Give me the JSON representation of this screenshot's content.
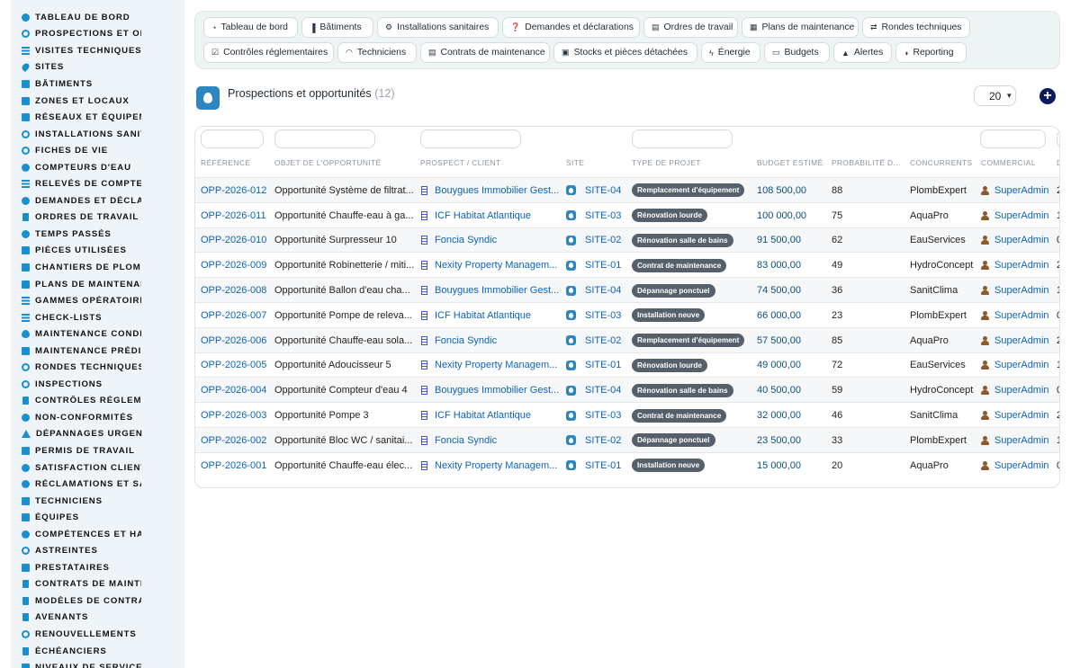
{
  "sidebar": {
    "items": [
      {
        "label": "TABLEAU DE BORD",
        "icon": "dashboard-icon"
      },
      {
        "label": "PROSPECTIONS ET OPPORTUNITÉS",
        "icon": "target-icon"
      },
      {
        "label": "VISITES TECHNIQUES ET AUDITS",
        "icon": "list-icon"
      },
      {
        "label": "SITES",
        "icon": "map-pin-icon"
      },
      {
        "label": "BÂTIMENTS",
        "icon": "building-icon"
      },
      {
        "label": "ZONES ET LOCAUX",
        "icon": "grid-icon"
      },
      {
        "label": "RÉSEAUX ET ÉQUIPEMENTS",
        "icon": "network-icon"
      },
      {
        "label": "INSTALLATIONS SANITAIRES",
        "icon": "cogs-icon"
      },
      {
        "label": "FICHES DE VIE",
        "icon": "history-icon"
      },
      {
        "label": "COMPTEURS D'EAU",
        "icon": "gauge-icon"
      },
      {
        "label": "RELEVÉS DE COMPTEURS",
        "icon": "list-icon"
      },
      {
        "label": "DEMANDES ET DÉCLARATIONS",
        "icon": "question-icon"
      },
      {
        "label": "ORDRES DE TRAVAIL",
        "icon": "clipboard-icon"
      },
      {
        "label": "TEMPS PASSÉS",
        "icon": "clock-icon"
      },
      {
        "label": "PIÈCES UTILISÉES",
        "icon": "boxes-icon"
      },
      {
        "label": "CHANTIERS DE PLOMBERIE",
        "icon": "hammer-icon"
      },
      {
        "label": "PLANS DE MAINTENANCE",
        "icon": "calendar-icon"
      },
      {
        "label": "GAMMES OPÉRATOIRES",
        "icon": "tasks-icon"
      },
      {
        "label": "CHECK-LISTS",
        "icon": "checklist-icon"
      },
      {
        "label": "MAINTENANCE CONDITIONNELLE",
        "icon": "thermometer-icon"
      },
      {
        "label": "MAINTENANCE PRÉDICTIVE",
        "icon": "chart-icon"
      },
      {
        "label": "RONDES TECHNIQUES",
        "icon": "route-icon"
      },
      {
        "label": "INSPECTIONS",
        "icon": "search-icon"
      },
      {
        "label": "CONTRÔLES RÉGLEMENTAIRES",
        "icon": "clipboard-check-icon"
      },
      {
        "label": "NON-CONFORMITÉS",
        "icon": "alert-circle-icon"
      },
      {
        "label": "DÉPANNAGES URGENTS",
        "icon": "warning-icon"
      },
      {
        "label": "PERMIS DE TRAVAIL",
        "icon": "id-card-icon"
      },
      {
        "label": "SATISFACTION CLIENT",
        "icon": "smile-icon"
      },
      {
        "label": "RÉCLAMATIONS ET SAV",
        "icon": "comment-icon"
      },
      {
        "label": "TECHNICIENS",
        "icon": "helmet-icon"
      },
      {
        "label": "ÉQUIPES",
        "icon": "users-icon"
      },
      {
        "label": "COMPÉTENCES ET HABILITATIONS",
        "icon": "certificate-icon"
      },
      {
        "label": "ASTREINTES",
        "icon": "phone-icon"
      },
      {
        "label": "PRESTATAIRES",
        "icon": "truck-icon"
      },
      {
        "label": "CONTRATS DE MAINTENANCE",
        "icon": "file-contract-icon"
      },
      {
        "label": "MODÈLES DE CONTRATS",
        "icon": "file-icon"
      },
      {
        "label": "AVENANTS",
        "icon": "file-edit-icon"
      },
      {
        "label": "RENOUVELLEMENTS",
        "icon": "refresh-icon"
      },
      {
        "label": "ÉCHÉANCIERS",
        "icon": "file-invoice-icon"
      },
      {
        "label": "NIVEAUX DE SERVICE (SLA)",
        "icon": "shield-icon"
      }
    ]
  },
  "topnav": {
    "row1": [
      {
        "label": "Tableau de bord",
        "icon": "dashboard-icon"
      },
      {
        "label": "Bâtiments",
        "icon": "building-icon"
      },
      {
        "label": "Installations sanitaires",
        "icon": "cogs-icon"
      },
      {
        "label": "Demandes et déclarations",
        "icon": "question-icon"
      },
      {
        "label": "Ordres de travail",
        "icon": "clipboard-icon"
      },
      {
        "label": "Plans de maintenance",
        "icon": "calendar-icon"
      },
      {
        "label": "Rondes techniques",
        "icon": "route-icon"
      }
    ],
    "row2": [
      {
        "label": "Contrôles réglementaires",
        "icon": "clipboard-check-icon"
      },
      {
        "label": "Techniciens",
        "icon": "helmet-icon"
      },
      {
        "label": "Contrats de maintenance",
        "icon": "file-contract-icon"
      },
      {
        "label": "Stocks et pièces détachées",
        "icon": "boxes-icon"
      },
      {
        "label": "Énergie",
        "icon": "bolt-icon"
      },
      {
        "label": "Budgets",
        "icon": "money-icon"
      },
      {
        "label": "Alertes",
        "icon": "bell-icon"
      },
      {
        "label": "Reporting",
        "icon": "pie-chart-icon"
      }
    ]
  },
  "page": {
    "title": "Prospections et opportunités",
    "count": "(12)",
    "page_size": "20",
    "add_icon": "plus-icon"
  },
  "table": {
    "columns": [
      "RÉFÉRENCE",
      "OBJET DE L'OPPORTUNITÉ",
      "PROSPECT / CLIENT",
      "SITE",
      "TYPE DE PROJET",
      "BUDGET ESTIMÉ",
      "PROBABILITÉ D...",
      "CONCURRENTS",
      "COMMERCIAL",
      "D"
    ],
    "rows": [
      {
        "ref": "OPP-2026-012",
        "objet": "Opportunité Système de filtrat...",
        "client": "Bouygues Immobilier Gest...",
        "site": "SITE-04",
        "type": "Remplacement d'équipement",
        "budget": "108 500,00",
        "proba": "88",
        "concurrent": "PlombExpert",
        "commercial": "SuperAdmin",
        "d": "2"
      },
      {
        "ref": "OPP-2026-011",
        "objet": "Opportunité Chauffe-eau à ga...",
        "client": "ICF Habitat Atlantique",
        "site": "SITE-03",
        "type": "Rénovation lourde",
        "budget": "100 000,00",
        "proba": "75",
        "concurrent": "AquaPro",
        "commercial": "SuperAdmin",
        "d": "1"
      },
      {
        "ref": "OPP-2026-010",
        "objet": "Opportunité Surpresseur 10",
        "client": "Foncia Syndic",
        "site": "SITE-02",
        "type": "Rénovation salle de bains",
        "budget": "91 500,00",
        "proba": "62",
        "concurrent": "EauServices",
        "commercial": "SuperAdmin",
        "d": "0"
      },
      {
        "ref": "OPP-2026-009",
        "objet": "Opportunité Robinetterie / miti...",
        "client": "Nexity Property Managem...",
        "site": "SITE-01",
        "type": "Contrat de maintenance",
        "budget": "83 000,00",
        "proba": "49",
        "concurrent": "HydroConcept",
        "commercial": "SuperAdmin",
        "d": "2"
      },
      {
        "ref": "OPP-2026-008",
        "objet": "Opportunité Ballon d'eau cha...",
        "client": "Bouygues Immobilier Gest...",
        "site": "SITE-04",
        "type": "Dépannage ponctuel",
        "budget": "74 500,00",
        "proba": "36",
        "concurrent": "SanitClima",
        "commercial": "SuperAdmin",
        "d": "1"
      },
      {
        "ref": "OPP-2026-007",
        "objet": "Opportunité Pompe de releva...",
        "client": "ICF Habitat Atlantique",
        "site": "SITE-03",
        "type": "Installation neuve",
        "budget": "66 000,00",
        "proba": "23",
        "concurrent": "PlombExpert",
        "commercial": "SuperAdmin",
        "d": "0"
      },
      {
        "ref": "OPP-2026-006",
        "objet": "Opportunité Chauffe-eau sola...",
        "client": "Foncia Syndic",
        "site": "SITE-02",
        "type": "Remplacement d'équipement",
        "budget": "57 500,00",
        "proba": "85",
        "concurrent": "AquaPro",
        "commercial": "SuperAdmin",
        "d": "2"
      },
      {
        "ref": "OPP-2026-005",
        "objet": "Opportunité Adoucisseur 5",
        "client": "Nexity Property Managem...",
        "site": "SITE-01",
        "type": "Rénovation lourde",
        "budget": "49 000,00",
        "proba": "72",
        "concurrent": "EauServices",
        "commercial": "SuperAdmin",
        "d": "1"
      },
      {
        "ref": "OPP-2026-004",
        "objet": "Opportunité Compteur d'eau 4",
        "client": "Bouygues Immobilier Gest...",
        "site": "SITE-04",
        "type": "Rénovation salle de bains",
        "budget": "40 500,00",
        "proba": "59",
        "concurrent": "HydroConcept",
        "commercial": "SuperAdmin",
        "d": "0"
      },
      {
        "ref": "OPP-2026-003",
        "objet": "Opportunité Pompe 3",
        "client": "ICF Habitat Atlantique",
        "site": "SITE-03",
        "type": "Contrat de maintenance",
        "budget": "32 000,00",
        "proba": "46",
        "concurrent": "SanitClima",
        "commercial": "SuperAdmin",
        "d": "2"
      },
      {
        "ref": "OPP-2026-002",
        "objet": "Opportunité Bloc WC / sanitai...",
        "client": "Foncia Syndic",
        "site": "SITE-02",
        "type": "Dépannage ponctuel",
        "budget": "23 500,00",
        "proba": "33",
        "concurrent": "PlombExpert",
        "commercial": "SuperAdmin",
        "d": "1"
      },
      {
        "ref": "OPP-2026-001",
        "objet": "Opportunité Chauffe-eau élec...",
        "client": "Nexity Property Managem...",
        "site": "SITE-01",
        "type": "Installation neuve",
        "budget": "15 000,00",
        "proba": "20",
        "concurrent": "AquaPro",
        "commercial": "SuperAdmin",
        "d": "0"
      }
    ]
  }
}
